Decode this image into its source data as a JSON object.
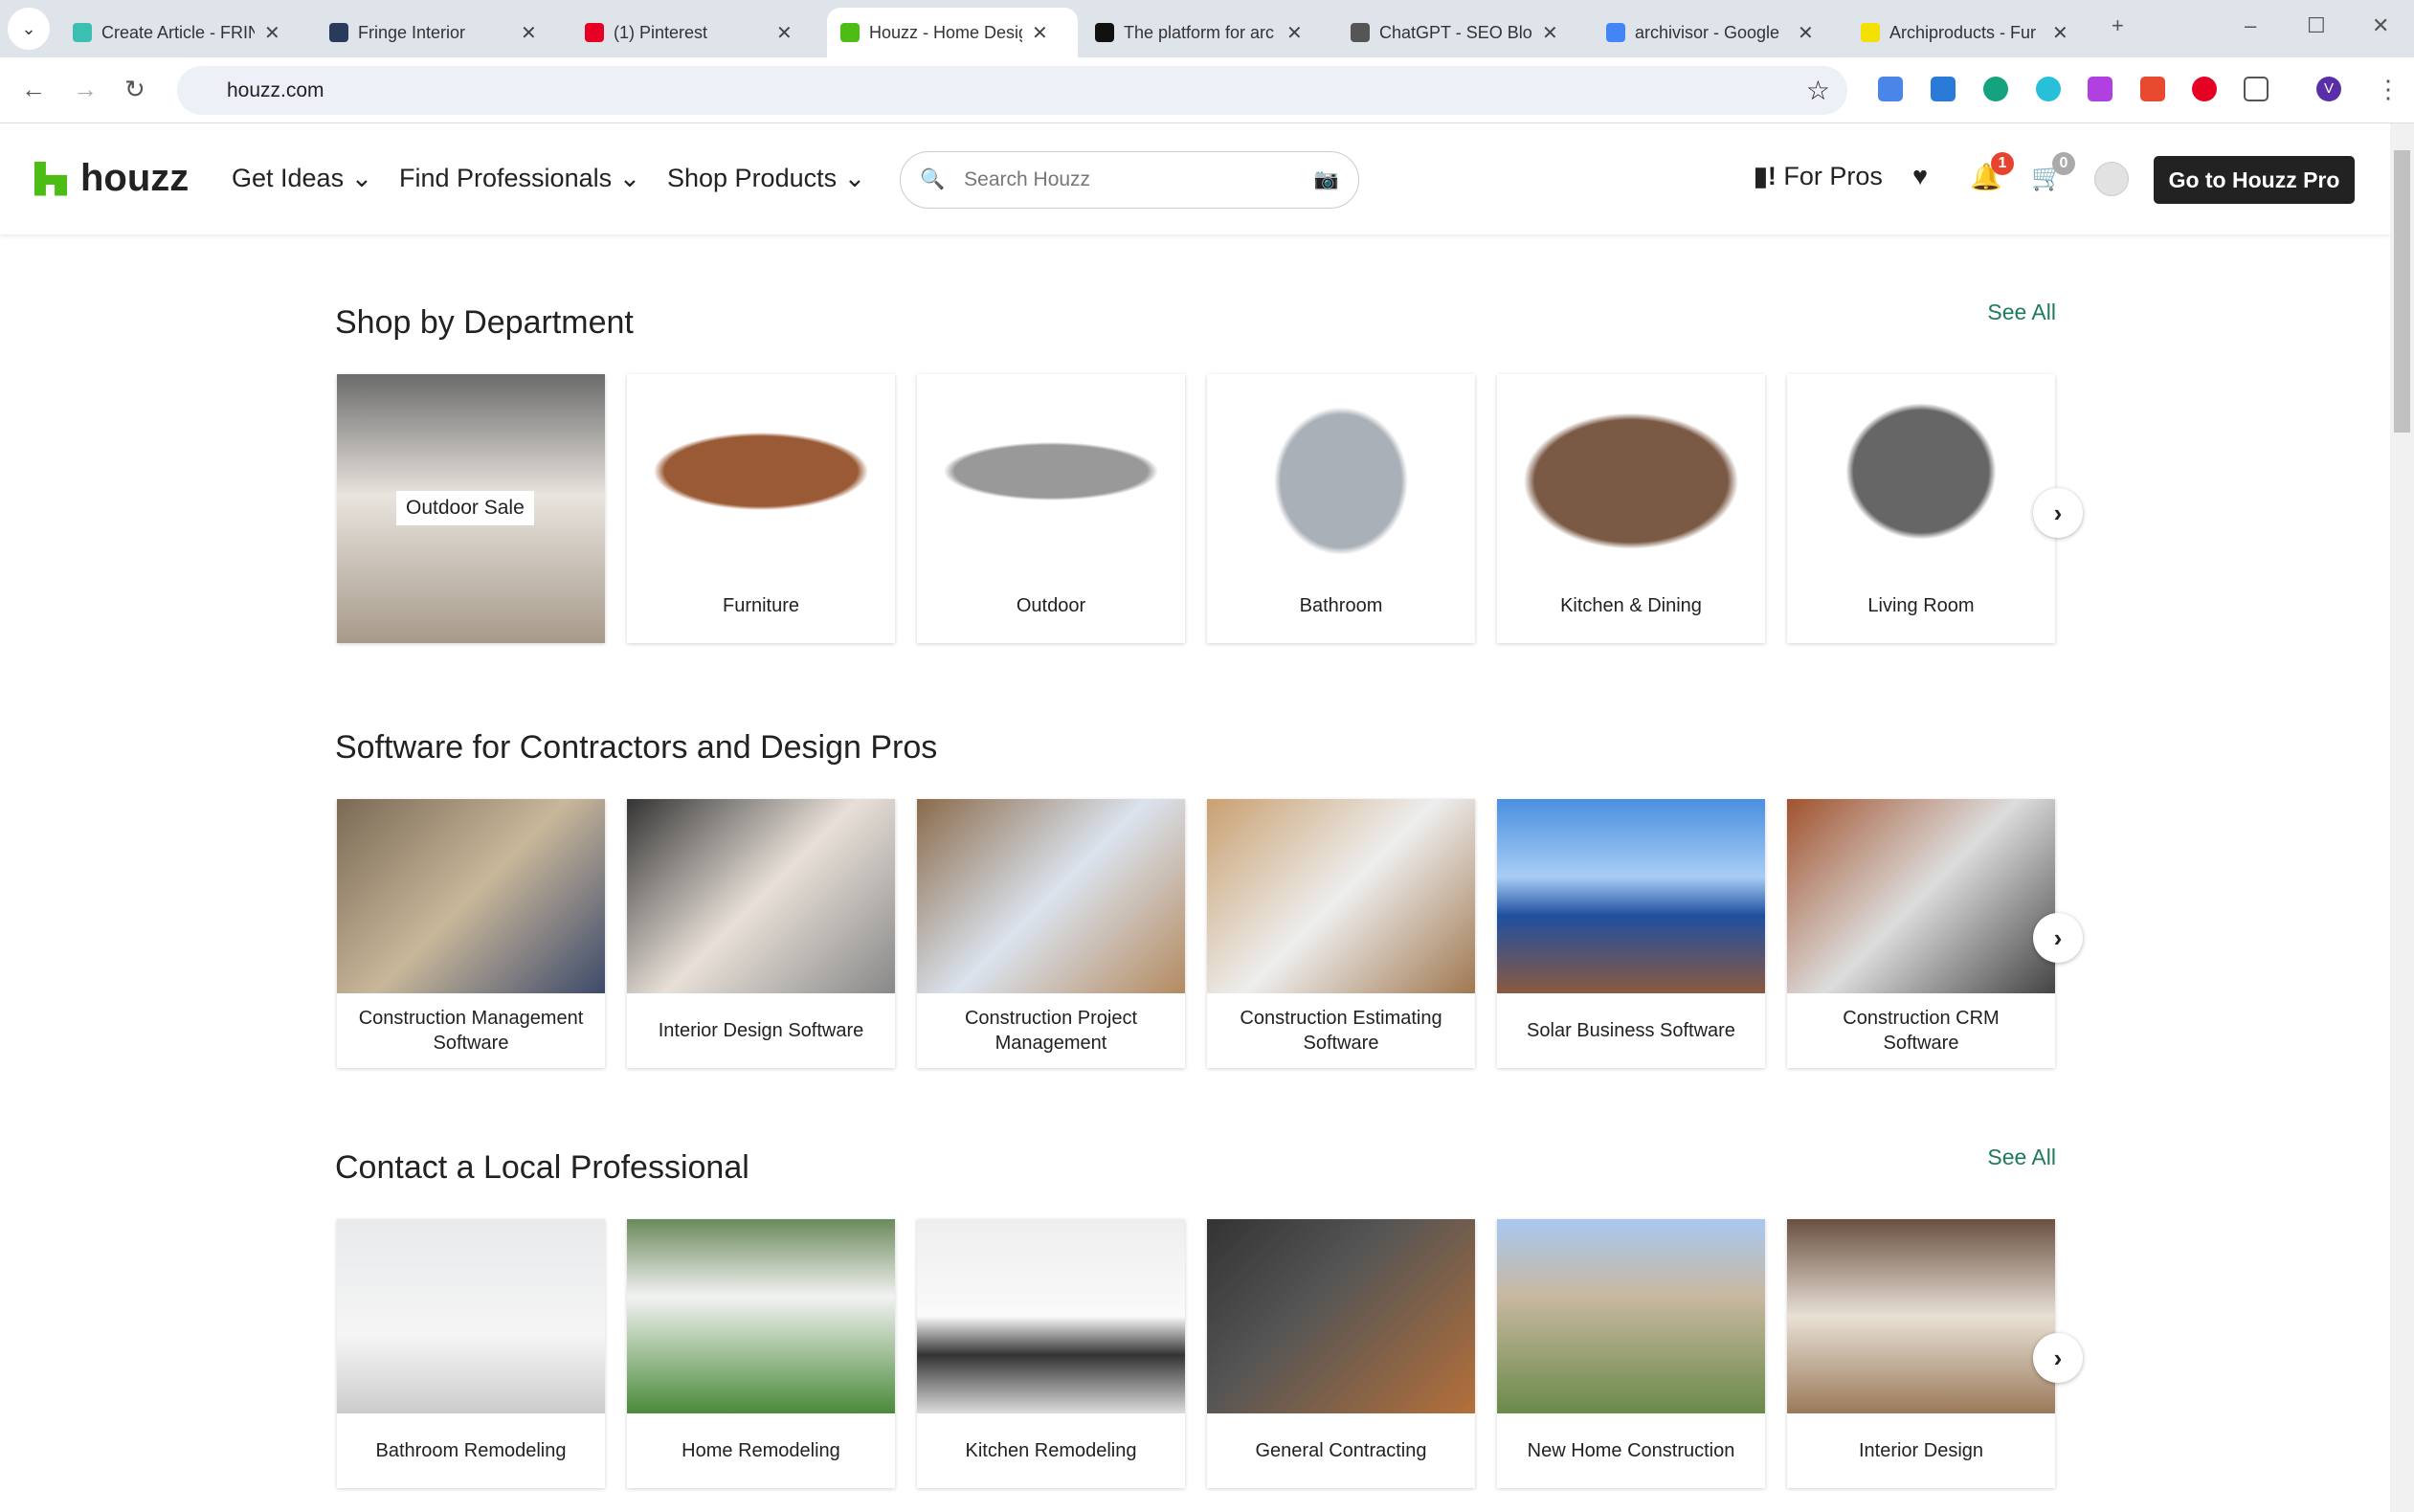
{
  "browser": {
    "tabs": [
      {
        "title": "Create Article - FRIN",
        "color": "#3bbfb0"
      },
      {
        "title": "Fringe Interior",
        "color": "#2a3a5a"
      },
      {
        "title": "(1) Pinterest",
        "color": "#e60023"
      },
      {
        "title": "Houzz - Home Design",
        "color": "#4dbc15",
        "active": true
      },
      {
        "title": "The platform for arc",
        "color": "#111"
      },
      {
        "title": "ChatGPT - SEO Blog",
        "color": "#555"
      },
      {
        "title": "archivisor - Google",
        "color": "#4285f4"
      },
      {
        "title": "Archiproducts - Fur",
        "color": "#f5e100"
      }
    ],
    "url": "houzz.com",
    "profile_initial": "V"
  },
  "header": {
    "logo": "houzz",
    "menu": [
      "Get Ideas",
      "Find Professionals",
      "Shop Products"
    ],
    "search_placeholder": "Search Houzz",
    "for_pros": "For Pros",
    "notifications_count": "1",
    "cart_count": "0",
    "pro_button": "Go to Houzz Pro"
  },
  "sections": [
    {
      "title": "Shop by Department",
      "see_all": "See All",
      "overlay": "Outdoor Sale",
      "cards": [
        {
          "label": "",
          "img": "linear-gradient(#6b6b6b,#e8e4de 45%,#a79a8a)"
        },
        {
          "label": "Furniture",
          "img": "radial-gradient(ellipse 40% 20% at 50% 50%,#9a5a35 90%,#fff 100%)"
        },
        {
          "label": "Outdoor",
          "img": "radial-gradient(ellipse 40% 15% at 50% 50%,#999 90%,#fff 100%)"
        },
        {
          "label": "Bathroom",
          "img": "radial-gradient(ellipse 25% 38% at 50% 55%,#aab0b8 90%,#fff 100%)"
        },
        {
          "label": "Kitchen & Dining",
          "img": "radial-gradient(ellipse 40% 35% at 50% 55%,#7a5a45 90%,#fff 100%)"
        },
        {
          "label": "Living Room",
          "img": "radial-gradient(ellipse 28% 35% at 50% 50%,#666 90%,#fff 100%)"
        }
      ]
    },
    {
      "title": "Software for Contractors and Design Pros",
      "cards": [
        {
          "label": "Construction Management Software",
          "img": "linear-gradient(135deg,#7a6a55,#c9b79a,#3c4a6a)"
        },
        {
          "label": "Interior Design Software",
          "img": "linear-gradient(135deg,#333,#e8e0d8,#888)"
        },
        {
          "label": "Construction Project Management",
          "img": "linear-gradient(135deg,#8a6a4a,#dbe3ee,#b48a60)"
        },
        {
          "label": "Construction Estimating Software",
          "img": "linear-gradient(135deg,#c9a070,#eee,#a07850)"
        },
        {
          "label": "Solar Business Software",
          "img": "linear-gradient(#4a8fe0,#a8cdf5 40%,#1f4fa0 60%,#8a5a40)"
        },
        {
          "label": "Construction CRM Software",
          "img": "linear-gradient(135deg,#a0522d,#ddd 50%,#444)"
        }
      ]
    },
    {
      "title": "Contact a Local Professional",
      "see_all": "See All",
      "cards": [
        {
          "label": "Bathroom Remodeling",
          "img": "linear-gradient(#e8eaec,#f5f5f5 60%,#ccc)"
        },
        {
          "label": "Home Remodeling",
          "img": "linear-gradient(#6a8a5a,#f2f2f2 40%,#4a8a3a)"
        },
        {
          "label": "Kitchen Remodeling",
          "img": "linear-gradient(#eee,#fafafa 50%,#333 70%,#ddd)"
        },
        {
          "label": "General Contracting",
          "img": "linear-gradient(135deg,#333,#555 40%,#b5703a)"
        },
        {
          "label": "New Home Construction",
          "img": "linear-gradient(#a8c8f0,#c8b8a0 40%,#6a8a4a)"
        },
        {
          "label": "Interior Design",
          "img": "linear-gradient(#6a5040,#e8e0d5 50%,#9a7a5a)"
        }
      ]
    }
  ]
}
